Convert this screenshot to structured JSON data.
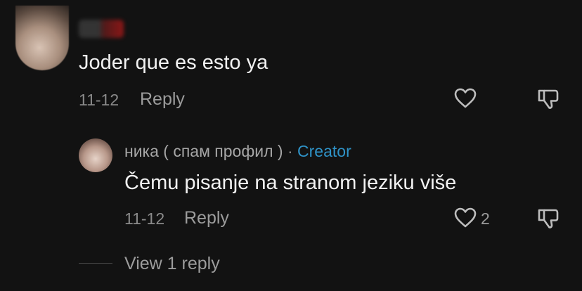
{
  "comment": {
    "username": "",
    "text": "Joder que es esto ya",
    "date": "11-12",
    "reply_label": "Reply",
    "like_icon": "heart-outline-icon",
    "dislike_icon": "thumbs-down-icon"
  },
  "reply": {
    "username": "ника ( спам профил )",
    "separator": "·",
    "badge": "Creator",
    "text": "Čemu pisanje na stranom jeziku više",
    "date": "11-12",
    "reply_label": "Reply",
    "like_count": "2",
    "like_icon": "heart-outline-icon",
    "dislike_icon": "thumbs-down-icon"
  },
  "view_replies_label": "View 1 reply",
  "colors": {
    "background": "#121212",
    "creator_badge": "#2f93c8",
    "muted_text": "#9c9c9c"
  }
}
